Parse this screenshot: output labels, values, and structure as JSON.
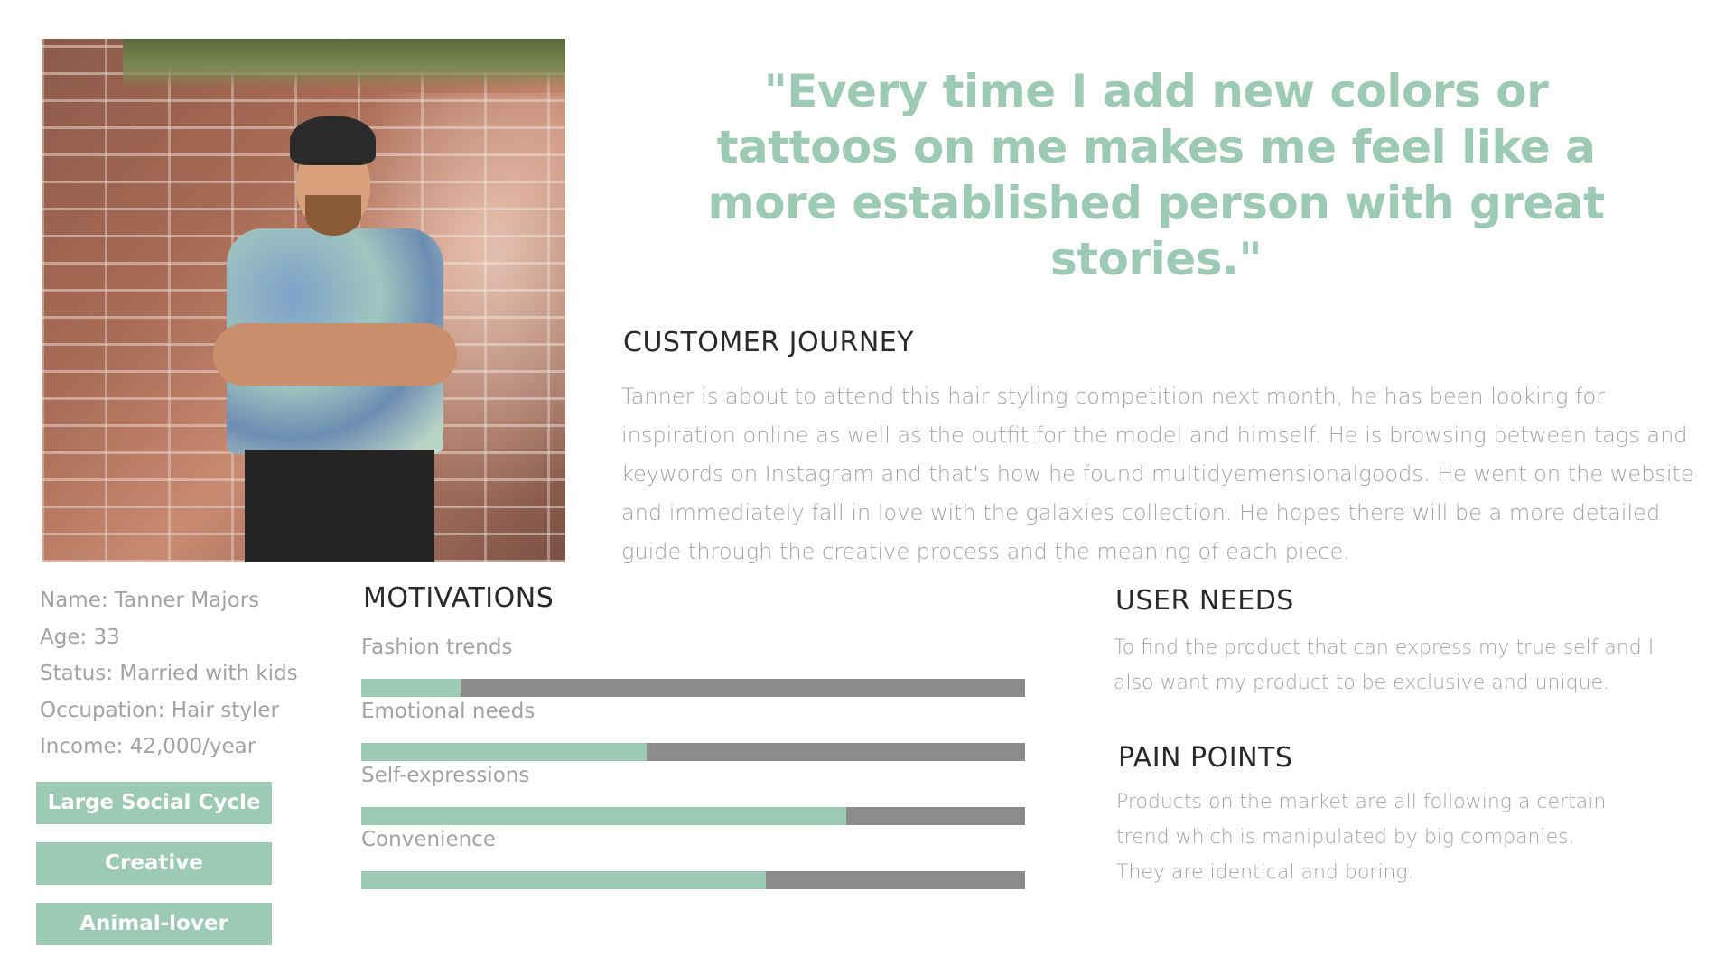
{
  "quote": "\"Every time I add new colors or tattoos on me makes me feel like a more established person with great stories.\"",
  "customer_journey": {
    "title": "CUSTOMER JOURNEY",
    "body": "Tanner is about to attend this hair styling competition next month, he has been looking for inspiration online as well as the outfit for the model and himself. He is browsing between tags and keywords on Instagram and that's how he found multidyemensionalgoods. He went on the website and immediately fall in love with the galaxies collection. He hopes there will be a more detailed guide through the creative process and the meaning of each piece."
  },
  "profile": {
    "name": "Name: Tanner Majors",
    "age": "Age: 33",
    "status": "Status: Married with kids",
    "occupation": "Occupation: Hair styler",
    "income": "Income: 42,000/year"
  },
  "tags": [
    "Large Social Cycle",
    "Creative",
    "Animal-lover"
  ],
  "motivations": {
    "title": "MOTIVATIONS",
    "items": [
      {
        "label": "Fashion trends",
        "level": 0.15
      },
      {
        "label": "Emotional needs",
        "level": 0.43
      },
      {
        "label": "Self-expressions",
        "level": 0.73
      },
      {
        "label": "Convenience",
        "level": 0.61
      }
    ]
  },
  "user_needs": {
    "title": "USER NEEDS",
    "body": "To find the product that can express my true self and I also want my product to be exclusive and unique."
  },
  "pain_points": {
    "title": "PAIN POINTS",
    "body": "Products on the market are all following a certain trend which is manipulated by big companies. They are identical and boring."
  },
  "colors": {
    "accent": "#9ccab4",
    "bar_track": "#8c8c8c",
    "heading": "#2a2a2a",
    "body": "#a3a3a3"
  }
}
